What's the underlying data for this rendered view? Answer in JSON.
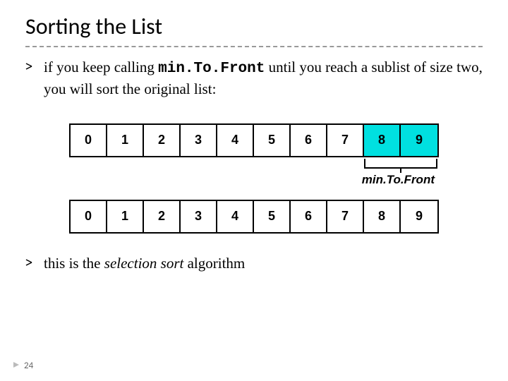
{
  "title": "Sorting the List",
  "bullet1_part1": "if you keep calling ",
  "bullet1_code": "min.To.Front",
  "bullet1_part2": " until you reach a sublist of size two, you will sort the original list:",
  "array1": [
    "0",
    "1",
    "2",
    "3",
    "4",
    "5",
    "6",
    "7",
    "8",
    "9"
  ],
  "array1_highlight_from": 8,
  "mtf_label": "min.To.Front",
  "array2": [
    "0",
    "1",
    "2",
    "3",
    "4",
    "5",
    "6",
    "7",
    "8",
    "9"
  ],
  "bullet2_part1": "this is the ",
  "bullet2_italic": "selection sort",
  "bullet2_part2": " algorithm",
  "page_number": "24"
}
